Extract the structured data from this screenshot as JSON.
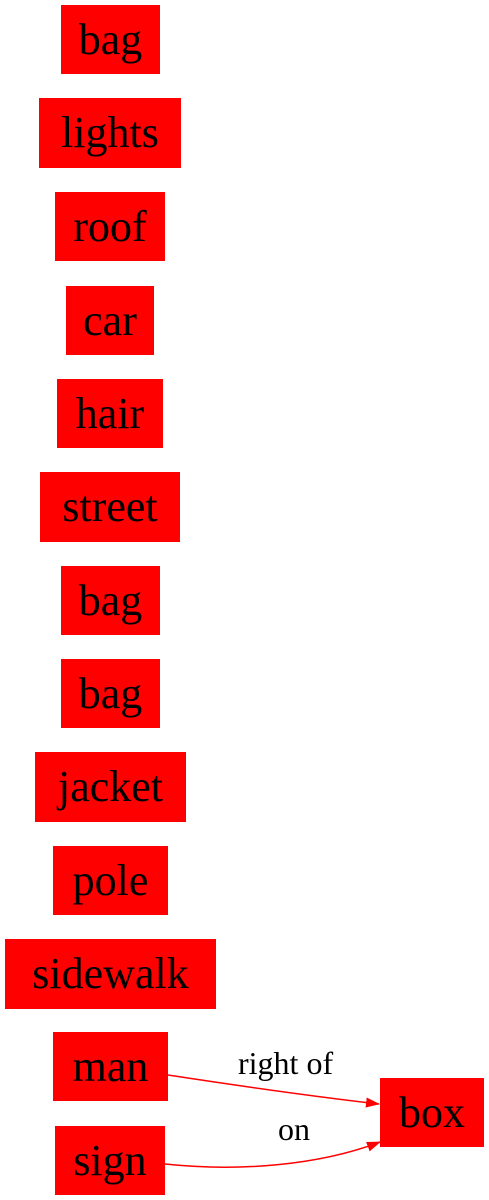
{
  "graph": {
    "node_color": "#ff0000",
    "edge_color": "#ff0000",
    "nodes": [
      {
        "id": "bag-1",
        "label": "bag"
      },
      {
        "id": "lights",
        "label": "lights"
      },
      {
        "id": "roof",
        "label": "roof"
      },
      {
        "id": "car",
        "label": "car"
      },
      {
        "id": "hair",
        "label": "hair"
      },
      {
        "id": "street",
        "label": "street"
      },
      {
        "id": "bag-2",
        "label": "bag"
      },
      {
        "id": "bag-3",
        "label": "bag"
      },
      {
        "id": "jacket",
        "label": "jacket"
      },
      {
        "id": "pole",
        "label": "pole"
      },
      {
        "id": "sidewalk",
        "label": "sidewalk"
      },
      {
        "id": "man",
        "label": "man"
      },
      {
        "id": "sign",
        "label": "sign"
      },
      {
        "id": "box",
        "label": "box"
      }
    ],
    "edges": [
      {
        "from": "man",
        "to": "box",
        "label": "right of"
      },
      {
        "from": "sign",
        "to": "box",
        "label": "on"
      }
    ]
  }
}
